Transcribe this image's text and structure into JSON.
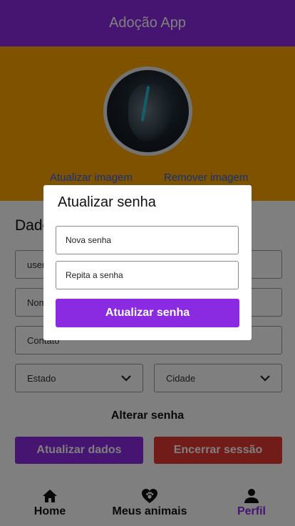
{
  "header": {
    "title": "Adoção App"
  },
  "profile": {
    "update_image": "Atualizar imagem",
    "remove_image": "Remover imagem"
  },
  "form": {
    "section_title": "Dados",
    "user_value": "user",
    "nome_placeholder": "Nome",
    "contato_placeholder": "Contato",
    "estado_label": "Estado",
    "cidade_label": "Cidade",
    "change_password": "Alterar senha",
    "update_button": "Atualizar dados",
    "logout_button": "Encerrar sessão"
  },
  "tabs": [
    {
      "label": "Home",
      "icon": "home-icon"
    },
    {
      "label": "Meus animais",
      "icon": "heart-paw-icon"
    },
    {
      "label": "Perfil",
      "icon": "person-icon"
    }
  ],
  "dialog": {
    "title": "Atualizar senha",
    "new_password_placeholder": "Nova senha",
    "repeat_password_placeholder": "Repita a senha",
    "submit_label": "Atualizar senha"
  },
  "colors": {
    "primary": "#8a2be2",
    "accent": "#ffa500",
    "danger": "#e53935",
    "link": "#2962ff"
  }
}
